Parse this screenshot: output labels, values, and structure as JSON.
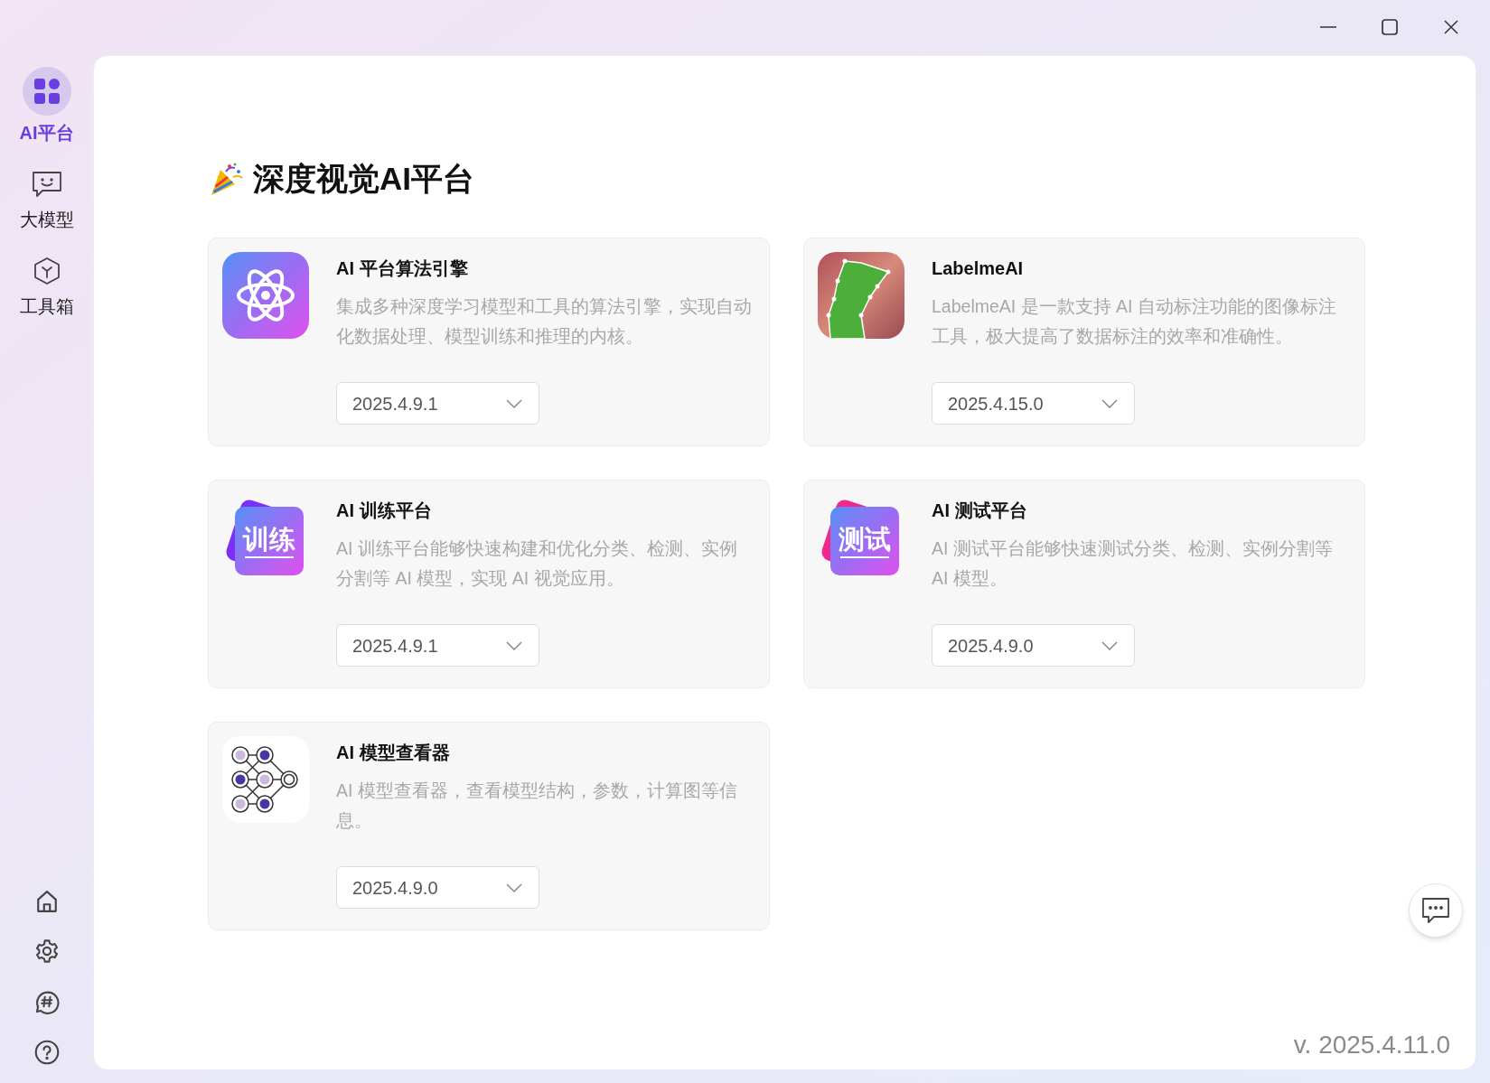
{
  "sidebar": {
    "items": [
      {
        "label": "AI平台",
        "kind": "grid",
        "selected": true
      },
      {
        "label": "大模型",
        "kind": "chat",
        "selected": false
      },
      {
        "label": "工具箱",
        "kind": "cube",
        "selected": false
      }
    ]
  },
  "page_title": "深度视觉AI平台",
  "apps": [
    {
      "kind": "atom",
      "title": "AI 平台算法引擎",
      "description": "集成多种深度学习模型和工具的算法引擎，实现自动化数据处理、模型训练和推理的内核。",
      "version": "2025.4.9.1"
    },
    {
      "kind": "photo",
      "title": "LabelmeAI",
      "description": "LabelmeAI 是一款支持 AI 自动标注功能的图像标注工具，极大提高了数据标注的效率和准确性。",
      "version": "2025.4.15.0"
    },
    {
      "kind": "tile",
      "icon_text": "训练",
      "color": "#7b2ff7",
      "title": "AI 训练平台",
      "description": "AI 训练平台能够快速构建和优化分类、检测、实例分割等 AI 模型，实现 AI 视觉应用。",
      "version": "2025.4.9.1"
    },
    {
      "kind": "tile",
      "icon_text": "测试",
      "color": "#f0288c",
      "title": "AI 测试平台",
      "description": "AI 测试平台能够快速测试分类、检测、实例分割等 AI 模型。",
      "version": "2025.4.9.0"
    },
    {
      "kind": "network",
      "title": "AI 模型查看器",
      "description": "AI 模型查看器，查看模型结构，参数，计算图等信息。",
      "version": "2025.4.9.0"
    }
  ],
  "app_version": "v. 2025.4.11.0"
}
